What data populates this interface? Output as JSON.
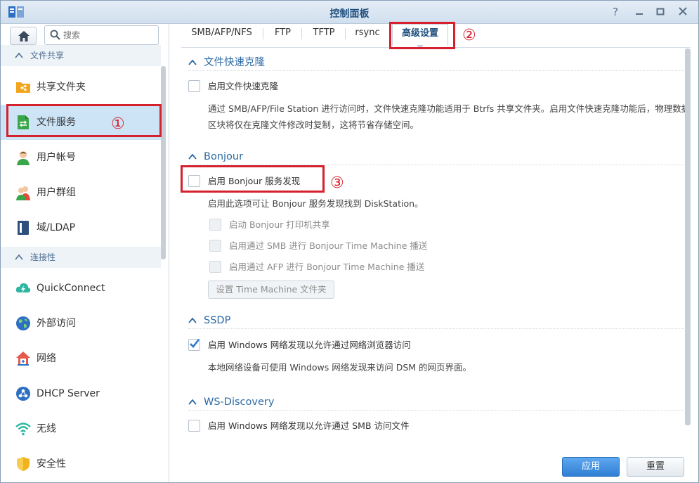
{
  "window": {
    "title": "控制面板"
  },
  "sidebar": {
    "search_placeholder": "搜索",
    "sections": [
      {
        "label": "文件共享"
      },
      {
        "label": "连接性"
      }
    ],
    "items": [
      {
        "label": "共享文件夹"
      },
      {
        "label": "文件服务"
      },
      {
        "label": "用户帐号"
      },
      {
        "label": "用户群组"
      },
      {
        "label": "域/LDAP"
      },
      {
        "label": "QuickConnect"
      },
      {
        "label": "外部访问"
      },
      {
        "label": "网络"
      },
      {
        "label": "DHCP Server"
      },
      {
        "label": "无线"
      },
      {
        "label": "安全性"
      }
    ]
  },
  "tabs": [
    {
      "label": "SMB/AFP/NFS"
    },
    {
      "label": "FTP"
    },
    {
      "label": "TFTP"
    },
    {
      "label": "rsync"
    },
    {
      "label": "高级设置"
    }
  ],
  "groups": {
    "clone": {
      "title": "文件快速克隆",
      "checkbox": "启用文件快速克隆",
      "desc1": "通过 SMB/AFP/File Station 进行访问时，文件快速克隆功能适用于 Btrfs 共享文件夹。启用文件快速克隆功能后，物理数据",
      "desc2": "区块将仅在克隆文件修改时复制，这将节省存储空间。"
    },
    "bonjour": {
      "title": "Bonjour",
      "checkbox": "启用 Bonjour 服务发现",
      "desc": "启用此选项可让 Bonjour 服务发现找到 DiskStation。",
      "sub1": "启动 Bonjour 打印机共享",
      "sub2": "启用通过 SMB 进行 Bonjour Time Machine 播送",
      "sub3": "启用通过 AFP 进行 Bonjour Time Machine 播送",
      "button": "设置 Time Machine 文件夹"
    },
    "ssdp": {
      "title": "SSDP",
      "checkbox": "启用 Windows 网络发现以允许通过网络浏览器访问",
      "desc": "本地网络设备可使用 Windows 网络发现来访问 DSM 的网页界面。"
    },
    "ws": {
      "title": "WS-Discovery",
      "checkbox": "启用 Windows 网络发现以允许通过 SMB 访问文件"
    }
  },
  "footer": {
    "apply": "应用",
    "reset": "重置"
  },
  "annotations": [
    "①",
    "②",
    "③"
  ],
  "colors": {
    "accent": "#2b6aa5",
    "annotation": "#d4212d",
    "active_row": "#cde4f7"
  }
}
